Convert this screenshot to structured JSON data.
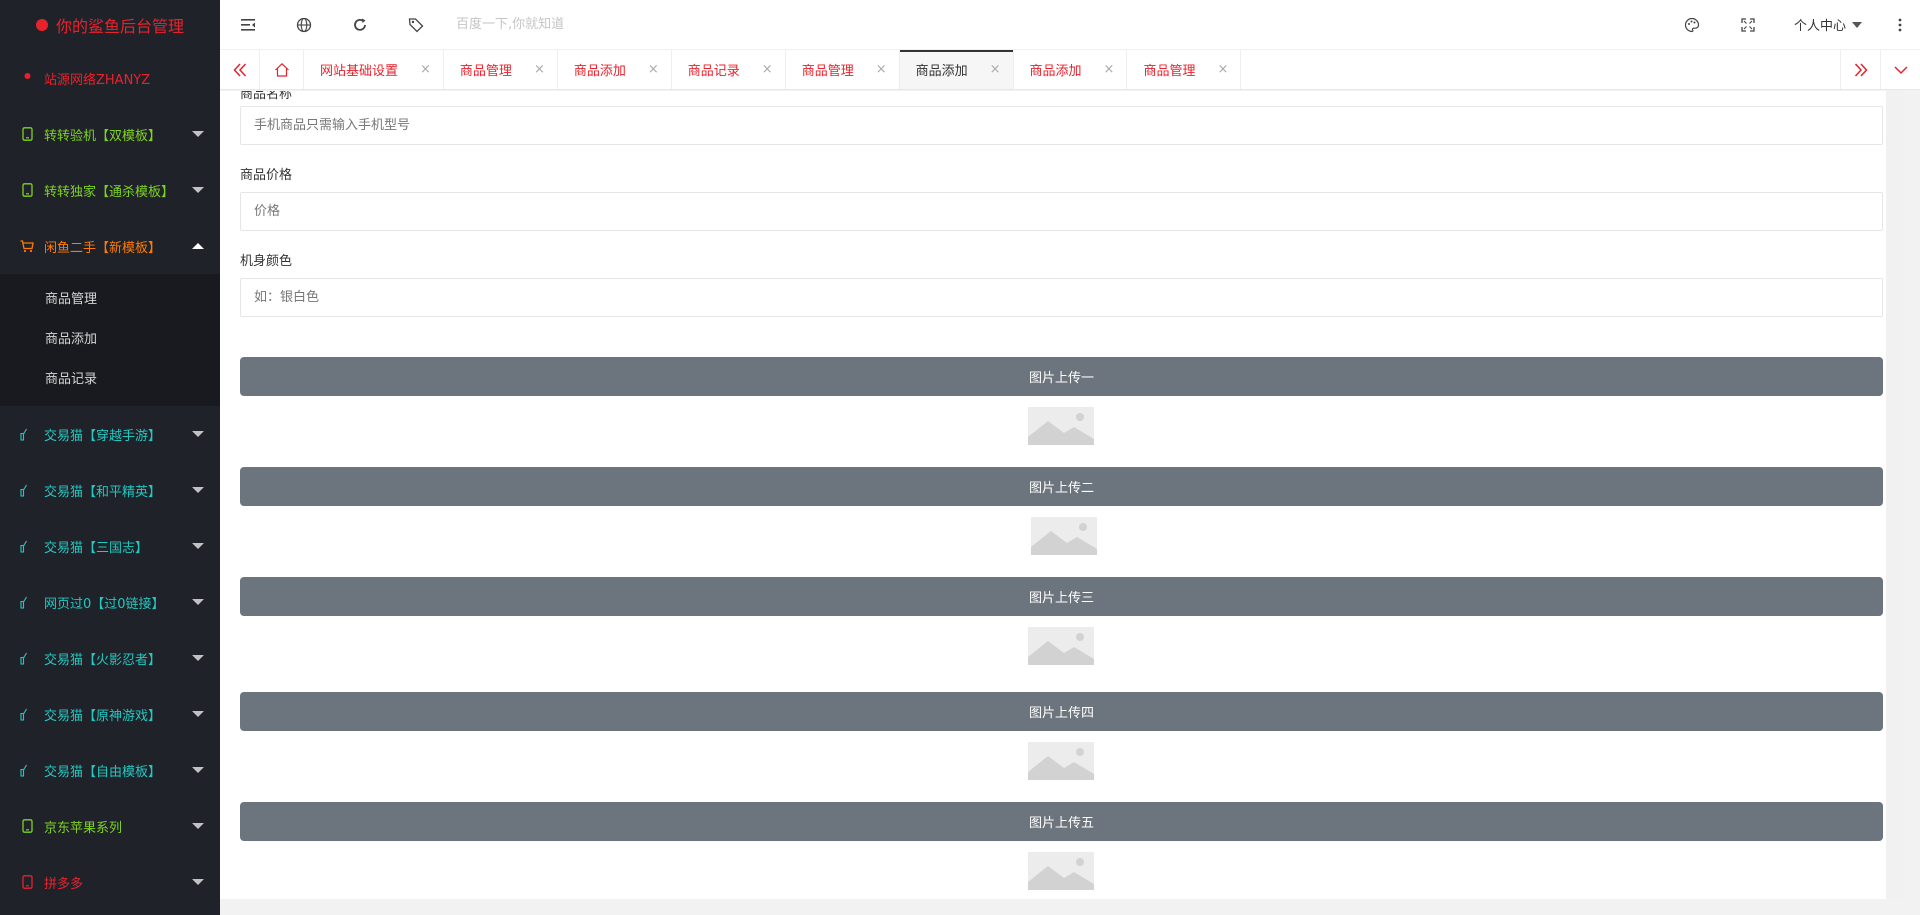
{
  "app": {
    "title": "你的鲨鱼后台管理",
    "accent": "#e8222c"
  },
  "sidebar": {
    "items": [
      {
        "label": "站源网络ZHANYZ",
        "icon": "user-icon",
        "color": "#e8222c",
        "arrow": "none"
      },
      {
        "label": "转转验机【双模板】",
        "icon": "phone-icon",
        "color": "#7ed321",
        "arrow": "down"
      },
      {
        "label": "转转独家【通杀模板】",
        "icon": "phone-icon",
        "color": "#7ed321",
        "arrow": "down"
      },
      {
        "label": "闲鱼二手【新模板】",
        "icon": "cart-icon",
        "color": "#ff7a00",
        "arrow": "up"
      }
    ],
    "submenu": [
      {
        "label": "商品管理"
      },
      {
        "label": "商品添加"
      },
      {
        "label": "商品记录"
      }
    ],
    "items2": [
      {
        "label": "交易猫【穿越手游】",
        "icon": "thumbs-up-icon",
        "color": "#20c9c1",
        "arrow": "down"
      },
      {
        "label": "交易猫【和平精英】",
        "icon": "thumbs-up-icon",
        "color": "#20c9c1",
        "arrow": "down"
      },
      {
        "label": "交易猫【三国志】",
        "icon": "thumbs-up-icon",
        "color": "#20c9c1",
        "arrow": "down"
      },
      {
        "label": "网页过0【过0链接】",
        "icon": "thumbs-up-icon",
        "color": "#20c9c1",
        "arrow": "down"
      },
      {
        "label": "交易猫【火影忍者】",
        "icon": "thumbs-up-icon",
        "color": "#20c9c1",
        "arrow": "down"
      },
      {
        "label": "交易猫【原神游戏】",
        "icon": "thumbs-up-icon",
        "color": "#20c9c1",
        "arrow": "down"
      },
      {
        "label": "交易猫【自由模板】",
        "icon": "thumbs-up-icon",
        "color": "#20c9c1",
        "arrow": "down"
      },
      {
        "label": "京东苹果系列",
        "icon": "phone-icon",
        "color": "#7ed321",
        "arrow": "down"
      },
      {
        "label": "拼多多",
        "icon": "phone-icon",
        "color": "#e8222c",
        "arrow": "down"
      }
    ]
  },
  "header": {
    "search_placeholder": "百度一下,你就知道",
    "user_center": "个人中心"
  },
  "tabs": [
    {
      "label": "网站基础设置",
      "active": false
    },
    {
      "label": "商品管理",
      "active": false
    },
    {
      "label": "商品添加",
      "active": false
    },
    {
      "label": "商品记录",
      "active": false
    },
    {
      "label": "商品管理",
      "active": false
    },
    {
      "label": "商品添加",
      "active": true
    },
    {
      "label": "商品添加",
      "active": false
    },
    {
      "label": "商品管理",
      "active": false
    }
  ],
  "tab_close": "×",
  "form": {
    "name_label": "商品名称",
    "name_placeholder": "手机商品只需输入手机型号",
    "price_label": "商品价格",
    "price_placeholder": "价格",
    "color_label": "机身颜色",
    "color_placeholder": "如：银白色",
    "uploads": [
      {
        "label": "图片上传一"
      },
      {
        "label": "图片上传二"
      },
      {
        "label": "图片上传三"
      },
      {
        "label": "图片上传四"
      },
      {
        "label": "图片上传五"
      }
    ]
  }
}
